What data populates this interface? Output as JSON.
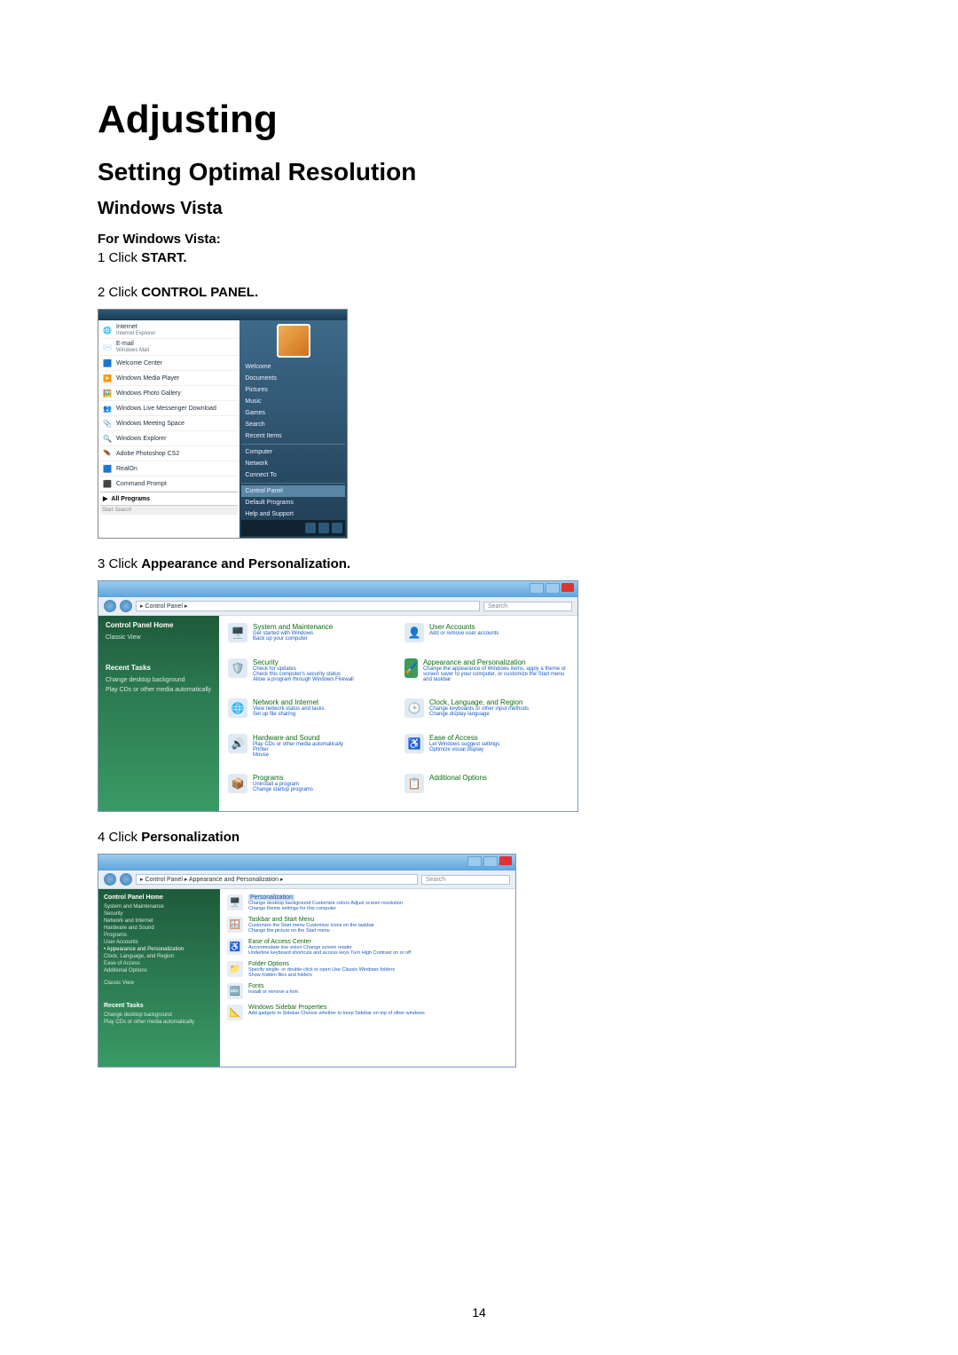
{
  "page_number": "14",
  "title": "Adjusting",
  "subtitle": "Setting Optimal Resolution",
  "subsub": "Windows Vista",
  "intro": "For Windows Vista:",
  "steps": {
    "s1_pre": "1 Click ",
    "s1_bold": "START.",
    "s2_pre": "2 Click ",
    "s2_bold": "CONTROL PANEL.",
    "s3_pre": "3 Click ",
    "s3_bold": "Appearance and Personalization.",
    "s4_pre": "4 Click ",
    "s4_bold": "Personalization"
  },
  "startmenu": {
    "left": [
      {
        "icon": "🌐",
        "label": "Internet",
        "sub": "Internet Explorer"
      },
      {
        "icon": "✉️",
        "label": "E-mail",
        "sub": "Windows Mail"
      },
      {
        "icon": "🟦",
        "label": "Welcome Center",
        "sub": ""
      },
      {
        "icon": "▶️",
        "label": "Windows Media Player",
        "sub": ""
      },
      {
        "icon": "🖼️",
        "label": "Windows Photo Gallery",
        "sub": ""
      },
      {
        "icon": "👥",
        "label": "Windows Live Messenger Download",
        "sub": ""
      },
      {
        "icon": "📎",
        "label": "Windows Meeting Space",
        "sub": ""
      },
      {
        "icon": "🔍",
        "label": "Windows Explorer",
        "sub": ""
      },
      {
        "icon": "🪶",
        "label": "Adobe Photoshop CS2",
        "sub": ""
      },
      {
        "icon": "🟦",
        "label": "RealOn",
        "sub": ""
      },
      {
        "icon": "⬛",
        "label": "Command Prompt",
        "sub": ""
      }
    ],
    "all_programs": "All Programs",
    "search": "Start Search",
    "right": [
      "Welcome",
      "Documents",
      "Pictures",
      "Music",
      "Games",
      "Search",
      "Recent Items",
      "Computer",
      "Network",
      "Connect To",
      "Control Panel",
      "Default Programs",
      "Help and Support"
    ],
    "right_selected": "Control Panel"
  },
  "control_panel": {
    "crumb": "▸ Control Panel ▸",
    "search": "Search",
    "side": {
      "heading": "Control Panel Home",
      "items": [
        "Classic View"
      ],
      "recent_h": "Recent Tasks",
      "recent_items": [
        "Change desktop background",
        "Play CDs or other media automatically"
      ]
    },
    "cats_left": [
      {
        "icon": "🖥️",
        "h": "System and Maintenance",
        "subs": [
          "Get started with Windows",
          "Back up your computer"
        ]
      },
      {
        "icon": "🛡️",
        "h": "Security",
        "subs": [
          "Check for updates",
          "Check this computer's security status",
          "Allow a program through Windows Firewall"
        ]
      },
      {
        "icon": "🌐",
        "h": "Network and Internet",
        "subs": [
          "View network status and tasks",
          "Set up file sharing"
        ]
      },
      {
        "icon": "🔊",
        "h": "Hardware and Sound",
        "subs": [
          "Play CDs or other media automatically",
          "Printer",
          "Mouse"
        ]
      },
      {
        "icon": "📦",
        "h": "Programs",
        "subs": [
          "Uninstall a program",
          "Change startup programs"
        ]
      }
    ],
    "cats_right": [
      {
        "icon": "👤",
        "h": "User Accounts",
        "subs": [
          "Add or remove user accounts"
        ]
      },
      {
        "icon": "🖌️",
        "h": "Appearance and Personalization",
        "subs": [
          "Change the appearance of Windows items, apply a theme or screen saver to your computer, or customize the Start menu and taskbar"
        ]
      },
      {
        "icon": "🕒",
        "h": "Clock, Language, and Region",
        "subs": [
          "Change keyboards or other input methods",
          "Change display language"
        ]
      },
      {
        "icon": "♿",
        "h": "Ease of Access",
        "subs": [
          "Let Windows suggest settings",
          "Optimize visual display"
        ]
      },
      {
        "icon": "📋",
        "h": "Additional Options",
        "subs": []
      }
    ]
  },
  "appearance": {
    "crumb": "▸ Control Panel ▸ Appearance and Personalization ▸",
    "search": "Search",
    "side": {
      "heading": "Control Panel Home",
      "items": [
        "System and Maintenance",
        "Security",
        "Network and Internet",
        "Hardware and Sound",
        "Programs",
        "User Accounts",
        "Appearance and Personalization",
        "Clock, Language, and Region",
        "Ease of Access",
        "Additional Options"
      ],
      "marked": "Appearance and Personalization",
      "classic": "Classic View",
      "recent_h": "Recent Tasks",
      "recent_items": [
        "Change desktop background",
        "Play CDs or other media automatically"
      ]
    },
    "rows": [
      {
        "icon": "🖥️",
        "h": "Personalization",
        "selected": true,
        "subs": [
          "Change desktop background    Customize colors    Adjust screen resolution",
          "Change theme settings for this computer"
        ]
      },
      {
        "icon": "🪟",
        "h": "Taskbar and Start Menu",
        "subs": [
          "Customize the Start menu    Customize icons on the taskbar",
          "Change the picture on the Start menu"
        ]
      },
      {
        "icon": "♿",
        "h": "Ease of Access Center",
        "subs": [
          "Accommodate low vision    Change screen reader",
          "Underline keyboard shortcuts and access keys    Turn High Contrast on or off"
        ]
      },
      {
        "icon": "📁",
        "h": "Folder Options",
        "subs": [
          "Specify single- or double-click to open    Use Classic Windows folders",
          "Show hidden files and folders"
        ]
      },
      {
        "icon": "🔤",
        "h": "Fonts",
        "subs": [
          "Install or remove a font"
        ]
      },
      {
        "icon": "📐",
        "h": "Windows Sidebar Properties",
        "subs": [
          "Add gadgets to Sidebar    Choose whether to keep Sidebar on top of other windows"
        ]
      }
    ]
  }
}
